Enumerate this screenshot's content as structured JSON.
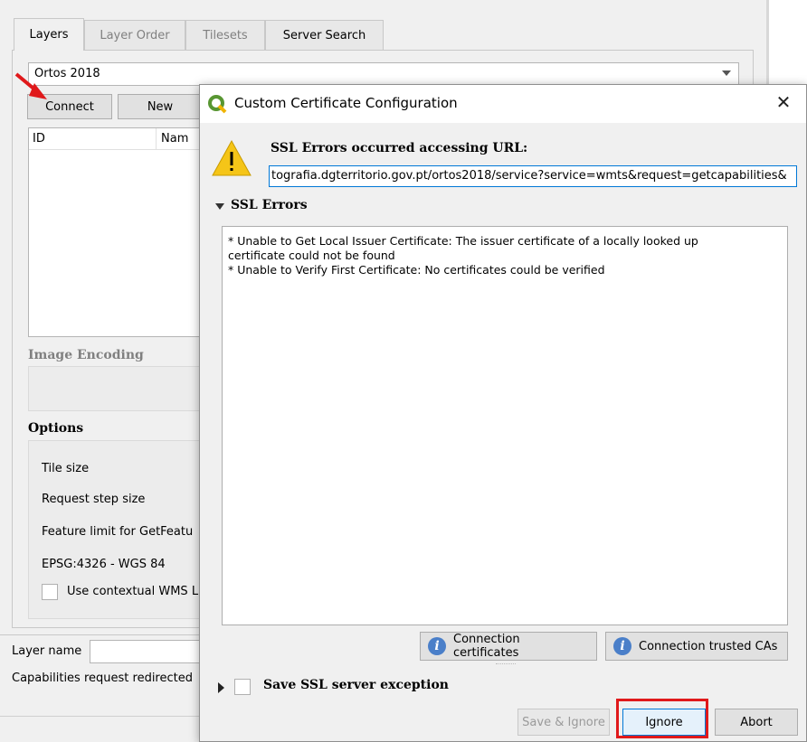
{
  "background_window": {
    "tabs": [
      "Layers",
      "Layer Order",
      "Tilesets",
      "Server Search"
    ],
    "connection_combo": "Ortos 2018",
    "connect_button": "Connect",
    "new_button": "New",
    "table_headers": [
      "ID",
      "Nam"
    ],
    "image_encoding_title": "Image Encoding",
    "options_title": "Options",
    "options": {
      "tile_size": "Tile size",
      "request_step_size": "Request step size",
      "feature_limit": "Feature limit for GetFeatu",
      "crs": "EPSG:4326 - WGS 84",
      "contextual": "Use contextual WMS L"
    },
    "layer_name_label": "Layer name",
    "capabilities_label": "Capabilities request redirected"
  },
  "dialog": {
    "title": "Custom Certificate Configuration",
    "close": "✕",
    "ssl_heading": "SSL Errors occurred accessing URL:",
    "url": "tografia.dgterritorio.gov.pt/ortos2018/service?service=wmts&request=getcapabilities&",
    "ssl_errors_label": "SSL Errors",
    "errors": [
      "* Unable to Get Local Issuer Certificate: The issuer certificate of a locally looked up",
      "certificate could not be found",
      "* Unable to Verify First Certificate: No certificates could be verified"
    ],
    "connection_certificates": "Connection certificates",
    "connection_trusted_cas": "Connection trusted CAs",
    "save_exception": "Save SSL server exception",
    "save_ignore": "Save & Ignore",
    "ignore": "Ignore",
    "abort": "Abort"
  },
  "colors": {
    "highlight": "#e0191b",
    "arrow": "#e0191b",
    "info_icon": "#4a7fc9",
    "warning": "#f5c518",
    "qgis_green": "#589632"
  }
}
